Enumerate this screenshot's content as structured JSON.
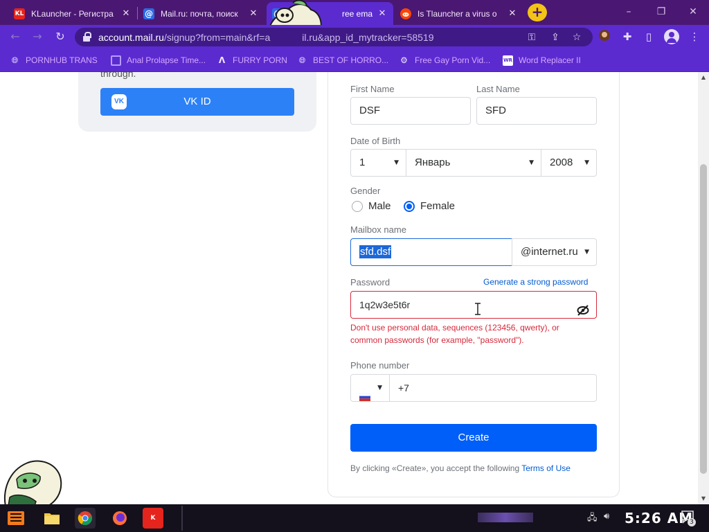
{
  "browser": {
    "tabs": [
      {
        "title": "KLauncher - Регистра",
        "favicon": "KL",
        "favicon_color": "#e5241d",
        "active": false
      },
      {
        "title": "Mail.ru: почта, поиск",
        "favicon": "@",
        "favicon_color": "#2d6be6",
        "active": false
      },
      {
        "title": "ree email — ",
        "favicon": "@",
        "favicon_color": "#2d6be6",
        "active": true
      },
      {
        "title": "Is Tlauncher a virus o",
        "favicon": "reddit",
        "favicon_color": "#ff4500",
        "active": false
      }
    ],
    "new_tab_symbol": "+",
    "url_domain": "account.mail.ru",
    "url_rest_a": "/signup?from=main&rf=a",
    "url_rest_b": "il.ru&app_id_mytracker=58519",
    "bookmarks": [
      {
        "label": "PORNHUB TRANS",
        "icon": "globe-icon"
      },
      {
        "label": "Anal Prolapse Time...",
        "icon": "bookmark-icon"
      },
      {
        "label": "FURRY PORN",
        "icon": "lambda-icon"
      },
      {
        "label": "BEST OF HORRO...",
        "icon": "globe-icon"
      },
      {
        "label": "Free Gay Porn Vid...",
        "icon": "bookmark-icon"
      },
      {
        "label": "Word Replacer II",
        "icon": "wr-icon"
      }
    ]
  },
  "left_panel": {
    "through_text": "through.",
    "vk_button_label": "VK ID",
    "vk_logo_text": "VK"
  },
  "form": {
    "first_name": {
      "label": "First Name",
      "value": "DSF"
    },
    "last_name": {
      "label": "Last Name",
      "value": "SFD"
    },
    "dob": {
      "label": "Date of Birth",
      "day": "1",
      "month": "Январь",
      "year": "2008"
    },
    "gender": {
      "label": "Gender",
      "options": [
        "Male",
        "Female"
      ],
      "selected": "Female"
    },
    "mailbox": {
      "label": "Mailbox name",
      "value": "sfd.dsf",
      "domain": "@internet.ru"
    },
    "password": {
      "label": "Password",
      "generate_link": "Generate a strong password",
      "value": "1q2w3e5t6r",
      "error_line1": "Don't use personal data, sequences (123456, qwerty), or",
      "error_line2": "common passwords (for example, \"password\")."
    },
    "phone": {
      "label": "Phone number",
      "prefix": "+7"
    },
    "create_button": "Create",
    "terms_text": "By clicking «Create», you accept the following ",
    "terms_link": "Terms of Use"
  },
  "taskbar": {
    "clock": "5:26 AM",
    "notification_count": "3"
  },
  "colors": {
    "tabstrip": "#4a1872",
    "toolbar": "#5b2bd0",
    "primary_button": "#005ff9",
    "vk_button": "#2d81f7",
    "error": "#d6283a"
  }
}
